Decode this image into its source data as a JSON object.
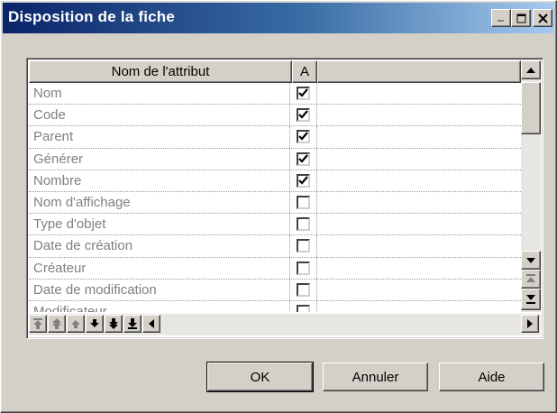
{
  "window": {
    "title": "Disposition de la fiche",
    "controls": {
      "minimize": "_",
      "maximize": "□",
      "close": "×"
    }
  },
  "grid": {
    "columns": [
      "Nom de l'attribut",
      "A",
      ""
    ],
    "rows": [
      {
        "name": "Nom",
        "checked": true
      },
      {
        "name": "Code",
        "checked": true
      },
      {
        "name": "Parent",
        "checked": true
      },
      {
        "name": "Générer",
        "checked": true
      },
      {
        "name": "Nombre",
        "checked": true
      },
      {
        "name": "Nom d'affichage",
        "checked": false
      },
      {
        "name": "Type d'objet",
        "checked": false
      },
      {
        "name": "Date de création",
        "checked": false
      },
      {
        "name": "Créateur",
        "checked": false
      },
      {
        "name": "Date de modification",
        "checked": false
      },
      {
        "name": "Modificateur",
        "checked": false
      }
    ],
    "move_buttons": [
      "move-top-icon",
      "move-up-page-icon",
      "move-up-icon",
      "move-down-icon",
      "move-down-page-icon",
      "move-bottom-icon"
    ]
  },
  "buttons": {
    "ok": "OK",
    "cancel": "Annuler",
    "help": "Aide"
  }
}
